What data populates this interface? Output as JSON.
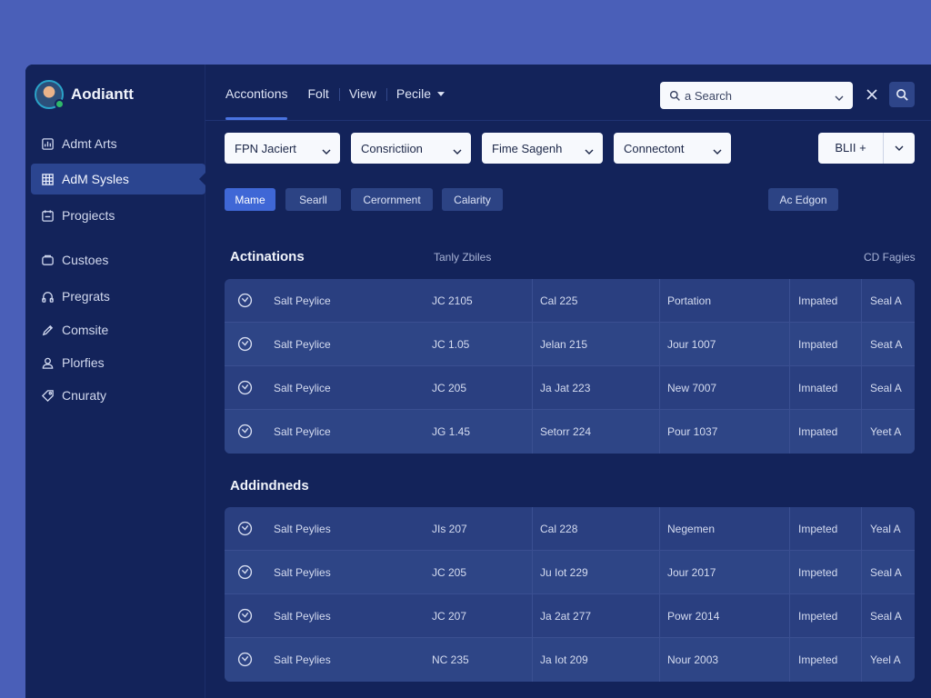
{
  "brand": {
    "name": "Aodiantt"
  },
  "sidebar": {
    "items": [
      {
        "label": "Admt Arts",
        "icon": "chart-icon"
      },
      {
        "label": "AdM Sysles",
        "icon": "grid-icon",
        "active": true
      },
      {
        "label": "Progiects",
        "icon": "folder-icon"
      },
      {
        "label": "Custoes",
        "icon": "box-icon"
      },
      {
        "label": "Pregrats",
        "icon": "headset-icon"
      },
      {
        "label": "Comsite",
        "icon": "pen-icon"
      },
      {
        "label": "Plorfies",
        "icon": "user-icon"
      },
      {
        "label": "Cnuraty",
        "icon": "tag-icon"
      }
    ]
  },
  "topbar": {
    "menu": [
      "Accontions",
      "Folt",
      "View",
      "Pecile"
    ],
    "search_placeholder": "a Search"
  },
  "filters": [
    "FPN Jaciert",
    "Consrictiion",
    "Fime Sagenh",
    "Connectont"
  ],
  "split_button": {
    "label": "BLII  +"
  },
  "chips": [
    "Mame",
    "Searll",
    "Cerornment",
    "Calarity"
  ],
  "action_chip": "Ac Edgon",
  "section1": {
    "title": "Actinations",
    "subtitle": "Tanly Zbiles",
    "right_label": "CD Fagies",
    "rows": [
      [
        "Salt Peylice",
        "JC 2105",
        "Cal 225",
        "Portation",
        "Impated",
        "Seal A"
      ],
      [
        "Salt Peylice",
        "JC 1.05",
        "Jelan 215",
        "Jour 1007",
        "Impated",
        "Seat A"
      ],
      [
        "Salt Peylice",
        "JC 205",
        "Ja Jat 223",
        "New 7007",
        "Imnated",
        "Seal A"
      ],
      [
        "Salt Peylice",
        "JG 1.45",
        "Setorr 224",
        "Pour 1037",
        "Impated",
        "Yeet A"
      ]
    ]
  },
  "section2": {
    "title": "Addindneds",
    "rows": [
      [
        "Salt Peylies",
        "JIs 207",
        "Cal 228",
        "Negemen",
        "Impeted",
        "Yeal A"
      ],
      [
        "Salt Peylies",
        "JC 205",
        "Ju Iot 229",
        "Jour 2017",
        "Impeted",
        "Seal A"
      ],
      [
        "Salt Peylies",
        "JC 207",
        "Ja 2at 277",
        "Powr 2014",
        "Impeted",
        "Seal A"
      ],
      [
        "Salt Peylies",
        "NC 235",
        "Ja Iot 209",
        "Nour 2003",
        "Impeted",
        "Yeel A"
      ]
    ]
  },
  "colors": {
    "background": "#4a5fb8",
    "panel": "#13235a",
    "table": "#2a3f80",
    "accent": "#3f67d6"
  }
}
